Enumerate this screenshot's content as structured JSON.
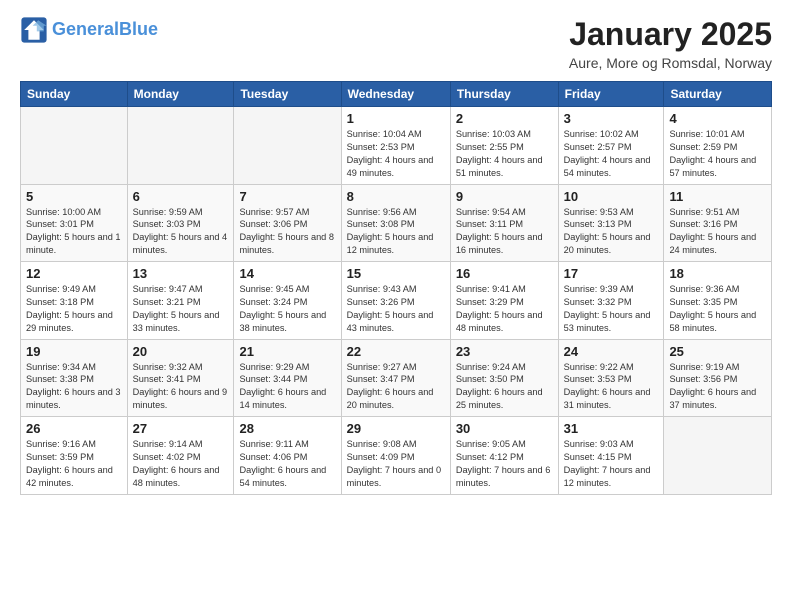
{
  "header": {
    "logo_line1": "General",
    "logo_line2": "Blue",
    "month_title": "January 2025",
    "subtitle": "Aure, More og Romsdal, Norway"
  },
  "weekdays": [
    "Sunday",
    "Monday",
    "Tuesday",
    "Wednesday",
    "Thursday",
    "Friday",
    "Saturday"
  ],
  "weeks": [
    [
      {
        "day": "",
        "info": ""
      },
      {
        "day": "",
        "info": ""
      },
      {
        "day": "",
        "info": ""
      },
      {
        "day": "1",
        "info": "Sunrise: 10:04 AM\nSunset: 2:53 PM\nDaylight: 4 hours and 49 minutes."
      },
      {
        "day": "2",
        "info": "Sunrise: 10:03 AM\nSunset: 2:55 PM\nDaylight: 4 hours and 51 minutes."
      },
      {
        "day": "3",
        "info": "Sunrise: 10:02 AM\nSunset: 2:57 PM\nDaylight: 4 hours and 54 minutes."
      },
      {
        "day": "4",
        "info": "Sunrise: 10:01 AM\nSunset: 2:59 PM\nDaylight: 4 hours and 57 minutes."
      }
    ],
    [
      {
        "day": "5",
        "info": "Sunrise: 10:00 AM\nSunset: 3:01 PM\nDaylight: 5 hours and 1 minute."
      },
      {
        "day": "6",
        "info": "Sunrise: 9:59 AM\nSunset: 3:03 PM\nDaylight: 5 hours and 4 minutes."
      },
      {
        "day": "7",
        "info": "Sunrise: 9:57 AM\nSunset: 3:06 PM\nDaylight: 5 hours and 8 minutes."
      },
      {
        "day": "8",
        "info": "Sunrise: 9:56 AM\nSunset: 3:08 PM\nDaylight: 5 hours and 12 minutes."
      },
      {
        "day": "9",
        "info": "Sunrise: 9:54 AM\nSunset: 3:11 PM\nDaylight: 5 hours and 16 minutes."
      },
      {
        "day": "10",
        "info": "Sunrise: 9:53 AM\nSunset: 3:13 PM\nDaylight: 5 hours and 20 minutes."
      },
      {
        "day": "11",
        "info": "Sunrise: 9:51 AM\nSunset: 3:16 PM\nDaylight: 5 hours and 24 minutes."
      }
    ],
    [
      {
        "day": "12",
        "info": "Sunrise: 9:49 AM\nSunset: 3:18 PM\nDaylight: 5 hours and 29 minutes."
      },
      {
        "day": "13",
        "info": "Sunrise: 9:47 AM\nSunset: 3:21 PM\nDaylight: 5 hours and 33 minutes."
      },
      {
        "day": "14",
        "info": "Sunrise: 9:45 AM\nSunset: 3:24 PM\nDaylight: 5 hours and 38 minutes."
      },
      {
        "day": "15",
        "info": "Sunrise: 9:43 AM\nSunset: 3:26 PM\nDaylight: 5 hours and 43 minutes."
      },
      {
        "day": "16",
        "info": "Sunrise: 9:41 AM\nSunset: 3:29 PM\nDaylight: 5 hours and 48 minutes."
      },
      {
        "day": "17",
        "info": "Sunrise: 9:39 AM\nSunset: 3:32 PM\nDaylight: 5 hours and 53 minutes."
      },
      {
        "day": "18",
        "info": "Sunrise: 9:36 AM\nSunset: 3:35 PM\nDaylight: 5 hours and 58 minutes."
      }
    ],
    [
      {
        "day": "19",
        "info": "Sunrise: 9:34 AM\nSunset: 3:38 PM\nDaylight: 6 hours and 3 minutes."
      },
      {
        "day": "20",
        "info": "Sunrise: 9:32 AM\nSunset: 3:41 PM\nDaylight: 6 hours and 9 minutes."
      },
      {
        "day": "21",
        "info": "Sunrise: 9:29 AM\nSunset: 3:44 PM\nDaylight: 6 hours and 14 minutes."
      },
      {
        "day": "22",
        "info": "Sunrise: 9:27 AM\nSunset: 3:47 PM\nDaylight: 6 hours and 20 minutes."
      },
      {
        "day": "23",
        "info": "Sunrise: 9:24 AM\nSunset: 3:50 PM\nDaylight: 6 hours and 25 minutes."
      },
      {
        "day": "24",
        "info": "Sunrise: 9:22 AM\nSunset: 3:53 PM\nDaylight: 6 hours and 31 minutes."
      },
      {
        "day": "25",
        "info": "Sunrise: 9:19 AM\nSunset: 3:56 PM\nDaylight: 6 hours and 37 minutes."
      }
    ],
    [
      {
        "day": "26",
        "info": "Sunrise: 9:16 AM\nSunset: 3:59 PM\nDaylight: 6 hours and 42 minutes."
      },
      {
        "day": "27",
        "info": "Sunrise: 9:14 AM\nSunset: 4:02 PM\nDaylight: 6 hours and 48 minutes."
      },
      {
        "day": "28",
        "info": "Sunrise: 9:11 AM\nSunset: 4:06 PM\nDaylight: 6 hours and 54 minutes."
      },
      {
        "day": "29",
        "info": "Sunrise: 9:08 AM\nSunset: 4:09 PM\nDaylight: 7 hours and 0 minutes."
      },
      {
        "day": "30",
        "info": "Sunrise: 9:05 AM\nSunset: 4:12 PM\nDaylight: 7 hours and 6 minutes."
      },
      {
        "day": "31",
        "info": "Sunrise: 9:03 AM\nSunset: 4:15 PM\nDaylight: 7 hours and 12 minutes."
      },
      {
        "day": "",
        "info": ""
      }
    ]
  ]
}
